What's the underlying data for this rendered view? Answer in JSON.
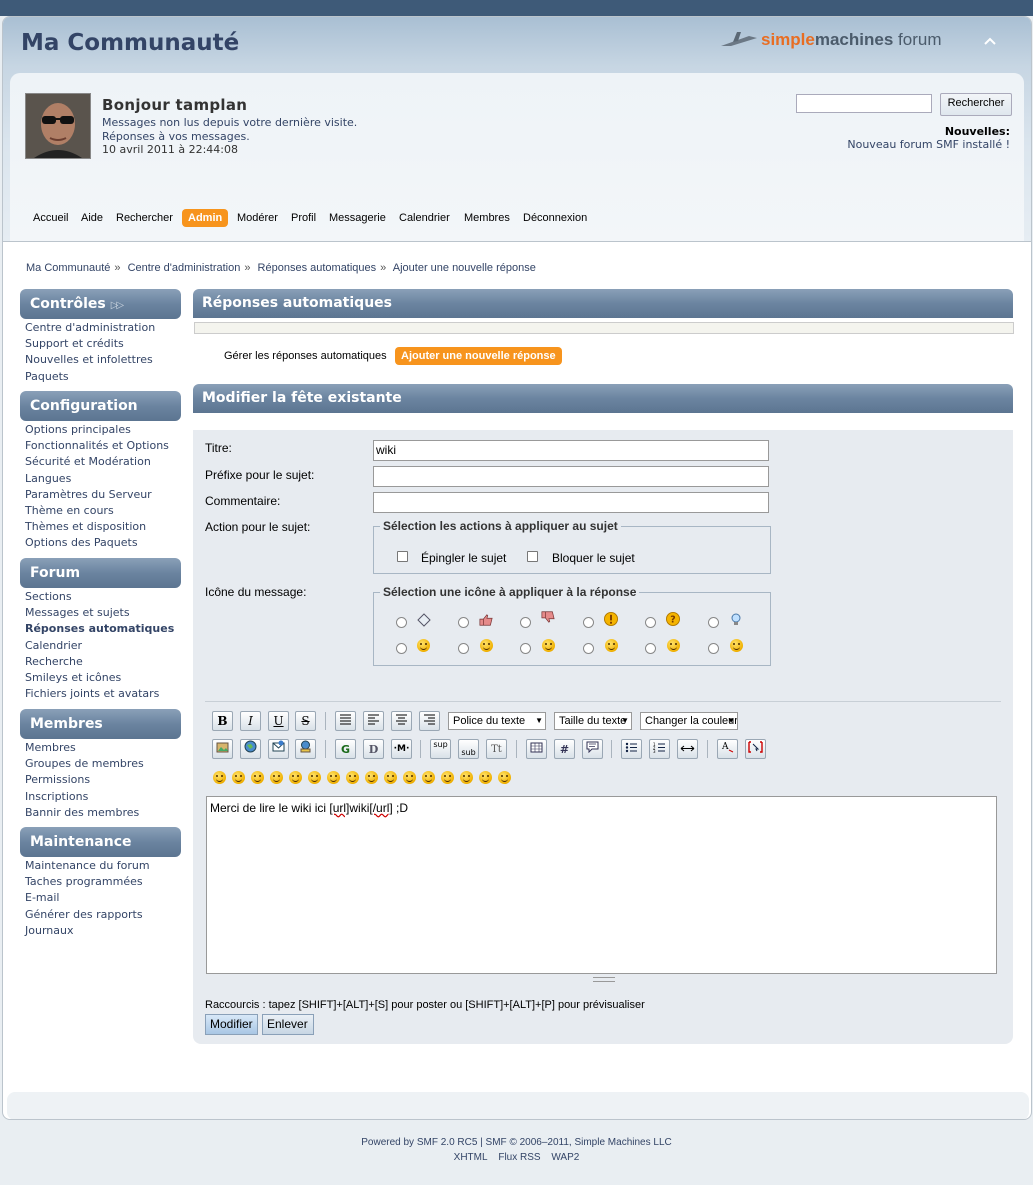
{
  "forum_title": "Ma Communauté",
  "logo": {
    "brand_a": "simple",
    "brand_b": "machines",
    "brand_c": "forum"
  },
  "user": {
    "greeting": "Bonjour tamplan",
    "unread": "Messages non lus depuis votre dernière visite.",
    "replies": "Réponses à vos messages.",
    "datetime": "10 avril 2011 à 22:44:08"
  },
  "search": {
    "button": "Rechercher",
    "placeholder": ""
  },
  "news": {
    "label": "Nouvelles:",
    "text": "Nouveau forum SMF installé !"
  },
  "menu": [
    "Accueil",
    "Aide",
    "Rechercher",
    "Admin",
    "Modérer",
    "Profil",
    "Messagerie",
    "Calendrier",
    "Membres",
    "Déconnexion"
  ],
  "breadcrumb": [
    "Ma Communauté",
    "Centre d'administration",
    "Réponses automatiques",
    "Ajouter une nouvelle réponse"
  ],
  "sidebar": {
    "controls": {
      "title": "Contrôles",
      "items": [
        "Centre d'administration",
        "Support et crédits",
        "Nouvelles et infolettres",
        "Paquets"
      ]
    },
    "configuration": {
      "title": "Configuration",
      "items": [
        "Options principales",
        "Fonctionnalités et Options",
        "Sécurité et Modération",
        "Langues",
        "Paramètres du Serveur",
        "Thème en cours",
        "Thèmes et disposition",
        "Options des Paquets"
      ]
    },
    "forum": {
      "title": "Forum",
      "items": [
        "Sections",
        "Messages et sujets",
        "Réponses automatiques",
        "Calendrier",
        "Recherche",
        "Smileys et icônes",
        "Fichiers joints et avatars"
      ]
    },
    "members": {
      "title": "Membres",
      "items": [
        "Membres",
        "Groupes de membres",
        "Permissions",
        "Inscriptions",
        "Bannir des membres"
      ]
    },
    "maintenance": {
      "title": "Maintenance",
      "items": [
        "Maintenance du forum",
        "Taches programmées",
        "E-mail",
        "Générer des rapports",
        "Journaux"
      ]
    }
  },
  "main": {
    "section_title": "Réponses automatiques",
    "tabs": [
      "Gérer les réponses automatiques",
      "Ajouter une nouvelle réponse"
    ],
    "form_title": "Modifier la fête existante",
    "fields": {
      "title_label": "Titre:",
      "title_value": "wiki",
      "prefix_label": "Préfixe pour le sujet:",
      "prefix_value": "",
      "comment_label": "Commentaire:",
      "comment_value": "",
      "action_label": "Action pour le sujet:",
      "action_legend": "Sélection les actions à appliquer au sujet",
      "pin_label": "Épingler le sujet",
      "lock_label": "Bloquer le sujet",
      "icon_label": "Icône du message:",
      "icon_legend": "Sélection une icône à appliquer à la réponse"
    },
    "editor": {
      "font_face": "Police du texte",
      "font_size": "Taille du texte",
      "font_color": "Changer la couleur",
      "message_before": "Merci de lire le wiki ici ",
      "message_tag_open": "[url]",
      "message_mid": "wiki",
      "message_tag_close": "[/url]",
      "message_after": "  ;D",
      "shortcut": "Raccourcis : tapez [SHIFT]+[ALT]+[S] pour poster ou [SHIFT]+[ALT]+[P] pour prévisualiser",
      "submit": "Modifier",
      "remove": "Enlever"
    }
  },
  "footer": {
    "powered": "Powered by SMF 2.0 RC5 | SMF © 2006–2011, Simple Machines LLC",
    "links": [
      "XHTML",
      "Flux RSS",
      "WAP2"
    ]
  },
  "colors": {
    "accent": "#f7941d",
    "header_bar": "#6b84a0",
    "link": "#334466"
  }
}
